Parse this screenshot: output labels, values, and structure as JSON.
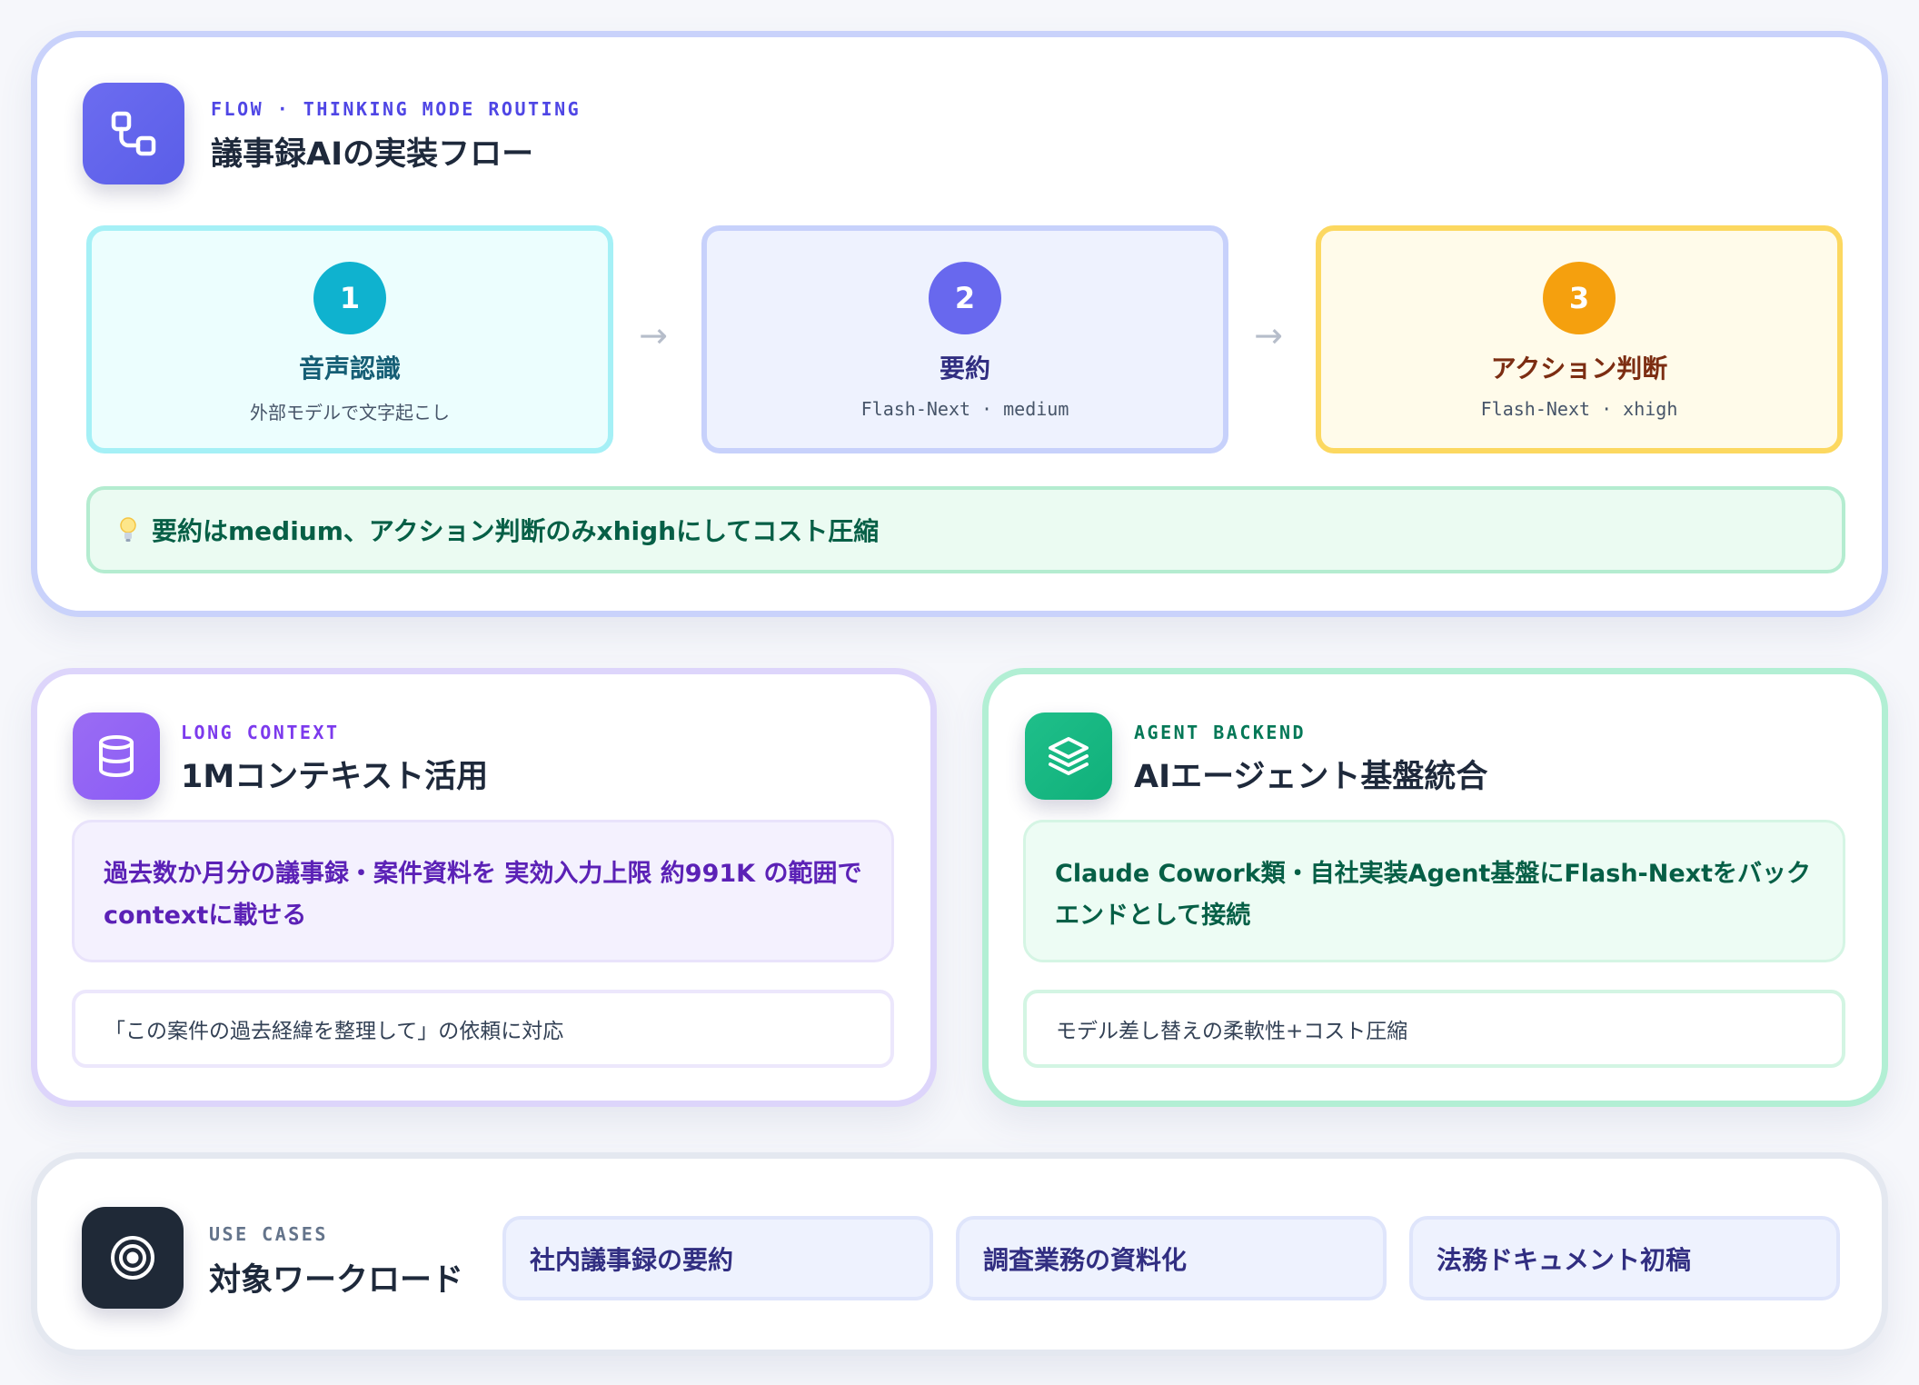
{
  "flow": {
    "eyebrow": "FLOW · THINKING MODE ROUTING",
    "title": "議事録AIの実装フロー",
    "icon": "workflow-icon",
    "steps": [
      {
        "number": "1",
        "title": "音声認識",
        "subtitle": "外部モデルで文字起こし",
        "color": "#0fb2cf"
      },
      {
        "number": "2",
        "title": "要約",
        "subtitle": "Flash-Next · medium",
        "color": "#6868ee"
      },
      {
        "number": "3",
        "title": "アクション判断",
        "subtitle": "Flash-Next · xhigh",
        "color": "#f5a00e"
      }
    ],
    "tip": {
      "icon": "lightbulb-icon",
      "text": "要約はmedium、アクション判断のみxhighにしてコスト圧縮"
    }
  },
  "long_context": {
    "eyebrow": "LONG CONTEXT",
    "title": "1Mコンテキスト活用",
    "icon": "database-icon",
    "body": "過去数か月分の議事録・案件資料を 実効入力上限 約991K の範囲でcontextに載せる",
    "note": "「この案件の過去経緯を整理して」の依頼に対応"
  },
  "agent_backend": {
    "eyebrow": "AGENT BACKEND",
    "title": "AIエージェント基盤統合",
    "icon": "layers-icon",
    "body": "Claude Cowork類・自社実装Agent基盤にFlash-Nextをバックエンドとして接続",
    "note": "モデル差し替えの柔軟性+コスト圧縮"
  },
  "use_cases": {
    "eyebrow": "USE CASES",
    "title": "対象ワークロード",
    "icon": "target-icon",
    "items": [
      "社内議事録の要約",
      "調査業務の資料化",
      "法務ドキュメント初稿"
    ]
  }
}
